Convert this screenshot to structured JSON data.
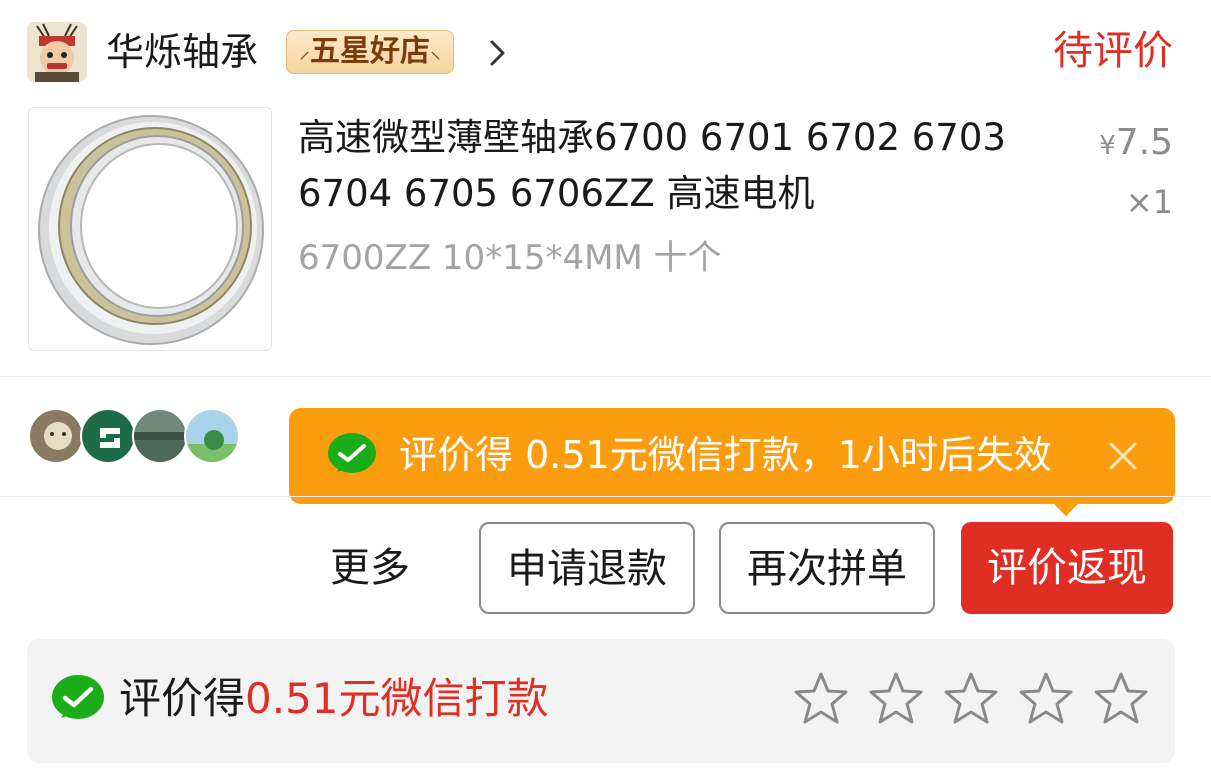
{
  "shop": {
    "name": "华烁轴承",
    "badge": "五星好店",
    "status": "待评价"
  },
  "product": {
    "title": "高速微型薄壁轴承6700 6701 6702 6703 6704 6705 6706ZZ 高速电机",
    "spec": "6700ZZ 10*15*4MM 十个",
    "currency": "¥",
    "price": "7.5",
    "quantity": "×1"
  },
  "cashback_tip": {
    "text": "评价得 0.51元微信打款，1小时后失效"
  },
  "actions": {
    "more": "更多",
    "refund": "申请退款",
    "rebuy": "再次拼单",
    "review": "评价返现"
  },
  "review_strip": {
    "prefix": "评价得",
    "highlight": "0.51元微信打款",
    "rating": 0,
    "max_rating": 5
  },
  "colors": {
    "accent_red": "#e02e24",
    "tip_orange": "#fb9d0e",
    "wechat_green": "#1aad19",
    "muted_gray": "#a3a3a3"
  }
}
